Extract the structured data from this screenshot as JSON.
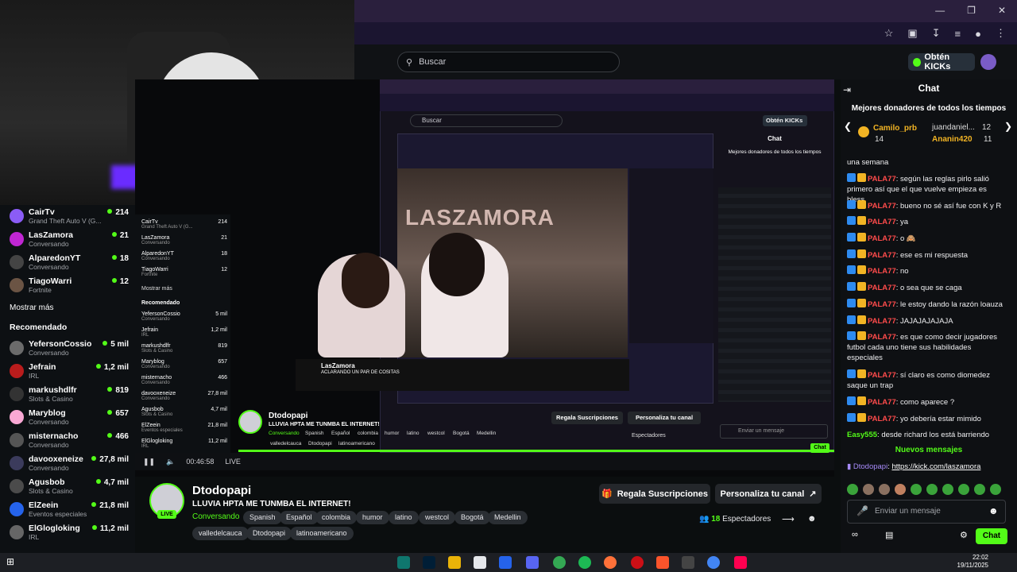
{
  "browser": {
    "search_placeholder": "Buscar",
    "kicks_button": "Obtén KICKs"
  },
  "sidebar": {
    "following": [
      {
        "name": "CairTv",
        "sub": "Grand Theft Auto V (G...",
        "count": "214"
      },
      {
        "name": "LasZamora",
        "sub": "Conversando",
        "count": "21"
      },
      {
        "name": "AlparedonYT",
        "sub": "Conversando",
        "count": "18"
      },
      {
        "name": "TiagoWarri",
        "sub": "Fortnite",
        "count": "12"
      }
    ],
    "show_more": "Mostrar más",
    "recommended_heading": "Recomendado",
    "recommended": [
      {
        "name": "YefersonCossio",
        "sub": "Conversando",
        "count": "5 mil"
      },
      {
        "name": "Jefrain",
        "sub": "IRL",
        "count": "1,2 mil"
      },
      {
        "name": "markushdlfr",
        "sub": "Slots & Casino",
        "count": "819"
      },
      {
        "name": "Maryblog",
        "sub": "Conversando",
        "count": "657"
      },
      {
        "name": "misternacho",
        "sub": "Conversando",
        "count": "466"
      },
      {
        "name": "davooxeneize",
        "sub": "Conversando",
        "count": "27,8 mil"
      },
      {
        "name": "Agusbob",
        "sub": "Slots & Casino",
        "count": "4,7 mil"
      },
      {
        "name": "ElZeein",
        "sub": "Eventos especiales",
        "count": "21,8 mil"
      },
      {
        "name": "ElGlogloking",
        "sub": "IRL",
        "count": "11,2 mil"
      }
    ]
  },
  "nested": {
    "search": "Buscar",
    "kicks": "Obtén KICKs",
    "chat_title": "Chat",
    "donors_title": "Mejores donadores de todos los tiempos",
    "stream_label": "LASZAMORA",
    "deep_title": "LasZamora",
    "deep_subtitle": "ACLARANDO UN PAR DE COSITAS",
    "inner_streamer": "Dtodopapi",
    "inner_title": "LLUVIA HPTA ME TUNMBA EL INTERNET!",
    "inner_tags": [
      "Conversando",
      "Spanish",
      "Español",
      "colombia",
      "humor",
      "latino",
      "westcol",
      "Bogotá",
      "Medellin"
    ],
    "inner_tags2": [
      "valledelcauca",
      "Dtodopapi",
      "latinoamericano"
    ],
    "inner_subs": "Regala Suscripciones",
    "inner_custom": "Personaliza tu canal",
    "inner_viewers": "Espectadores",
    "inner_chat_placeholder": "Enviar un mensaje",
    "inner_chat_btn": "Chat"
  },
  "player": {
    "time": "00:46:58",
    "live": "LIVE"
  },
  "stream": {
    "streamer": "Dtodopapi",
    "live_badge": "LIVE",
    "title": "LLUVIA HPTA ME TUNMBA EL INTERNET!",
    "category": "Conversando",
    "tags": [
      "Spanish",
      "Español",
      "colombia",
      "humor",
      "latino",
      "westcol",
      "Bogotá",
      "Medellin"
    ],
    "tags2": [
      "valledelcauca",
      "Dtodopapi",
      "latinoamericano"
    ],
    "subs_button": "Regala Suscripciones",
    "customize_button": "Personaliza tu canal",
    "viewers_count": "18",
    "viewers_label": "Espectadores"
  },
  "chat": {
    "title": "Chat",
    "donors_title": "Mejores donadores de todos los tiempos",
    "donors": [
      {
        "name": "Camilo_prb",
        "amount": "14"
      },
      {
        "name": "juandaniel...",
        "amount": "12"
      },
      {
        "name": "Ananin420",
        "amount": "11"
      }
    ],
    "first_line": "una semana",
    "messages": [
      {
        "user": "PALA77",
        "text": ": según las reglas pirlo salió primero así que el que vuelve empieza es bless"
      },
      {
        "user": "PALA77",
        "text": ": bueno no sé así fue con K y R"
      },
      {
        "user": "PALA77",
        "text": ": ya"
      },
      {
        "user": "PALA77",
        "text": ": o 🙈"
      },
      {
        "user": "PALA77",
        "text": ": ese es mi respuesta"
      },
      {
        "user": "PALA77",
        "text": ": no"
      },
      {
        "user": "PALA77",
        "text": ": o sea que se caga"
      },
      {
        "user": "PALA77",
        "text": ": le estoy dando la razón loauza"
      },
      {
        "user": "PALA77",
        "text": ": JAJAJAJAJAJA"
      },
      {
        "user": "PALA77",
        "text": ": es que como decir jugadores futbol cada uno tiene sus habilidades especiales"
      },
      {
        "user": "PALA77",
        "text": ": sí claro es como diomedez saque un trap"
      },
      {
        "user": "PALA77",
        "text": ": como aparece ?"
      },
      {
        "user": "PALA77",
        "text": ": yo debería estar mimido"
      }
    ],
    "last_message": {
      "user": "Easy555",
      "text": ": desde richard los está barriendo"
    },
    "new_messages": "Nuevos mensajes",
    "pinned_user": "Dtodopapi",
    "pinned_link": "https://kick.com/laszamora",
    "input_placeholder": "Enviar un mensaje",
    "send_button": "Chat"
  },
  "taskbar": {
    "time": "22:02",
    "date": "19/11/2025"
  },
  "colors": {
    "kick_green": "#53fc18",
    "username_red": "#ff4b4b",
    "bg": "#0b0e0f"
  }
}
